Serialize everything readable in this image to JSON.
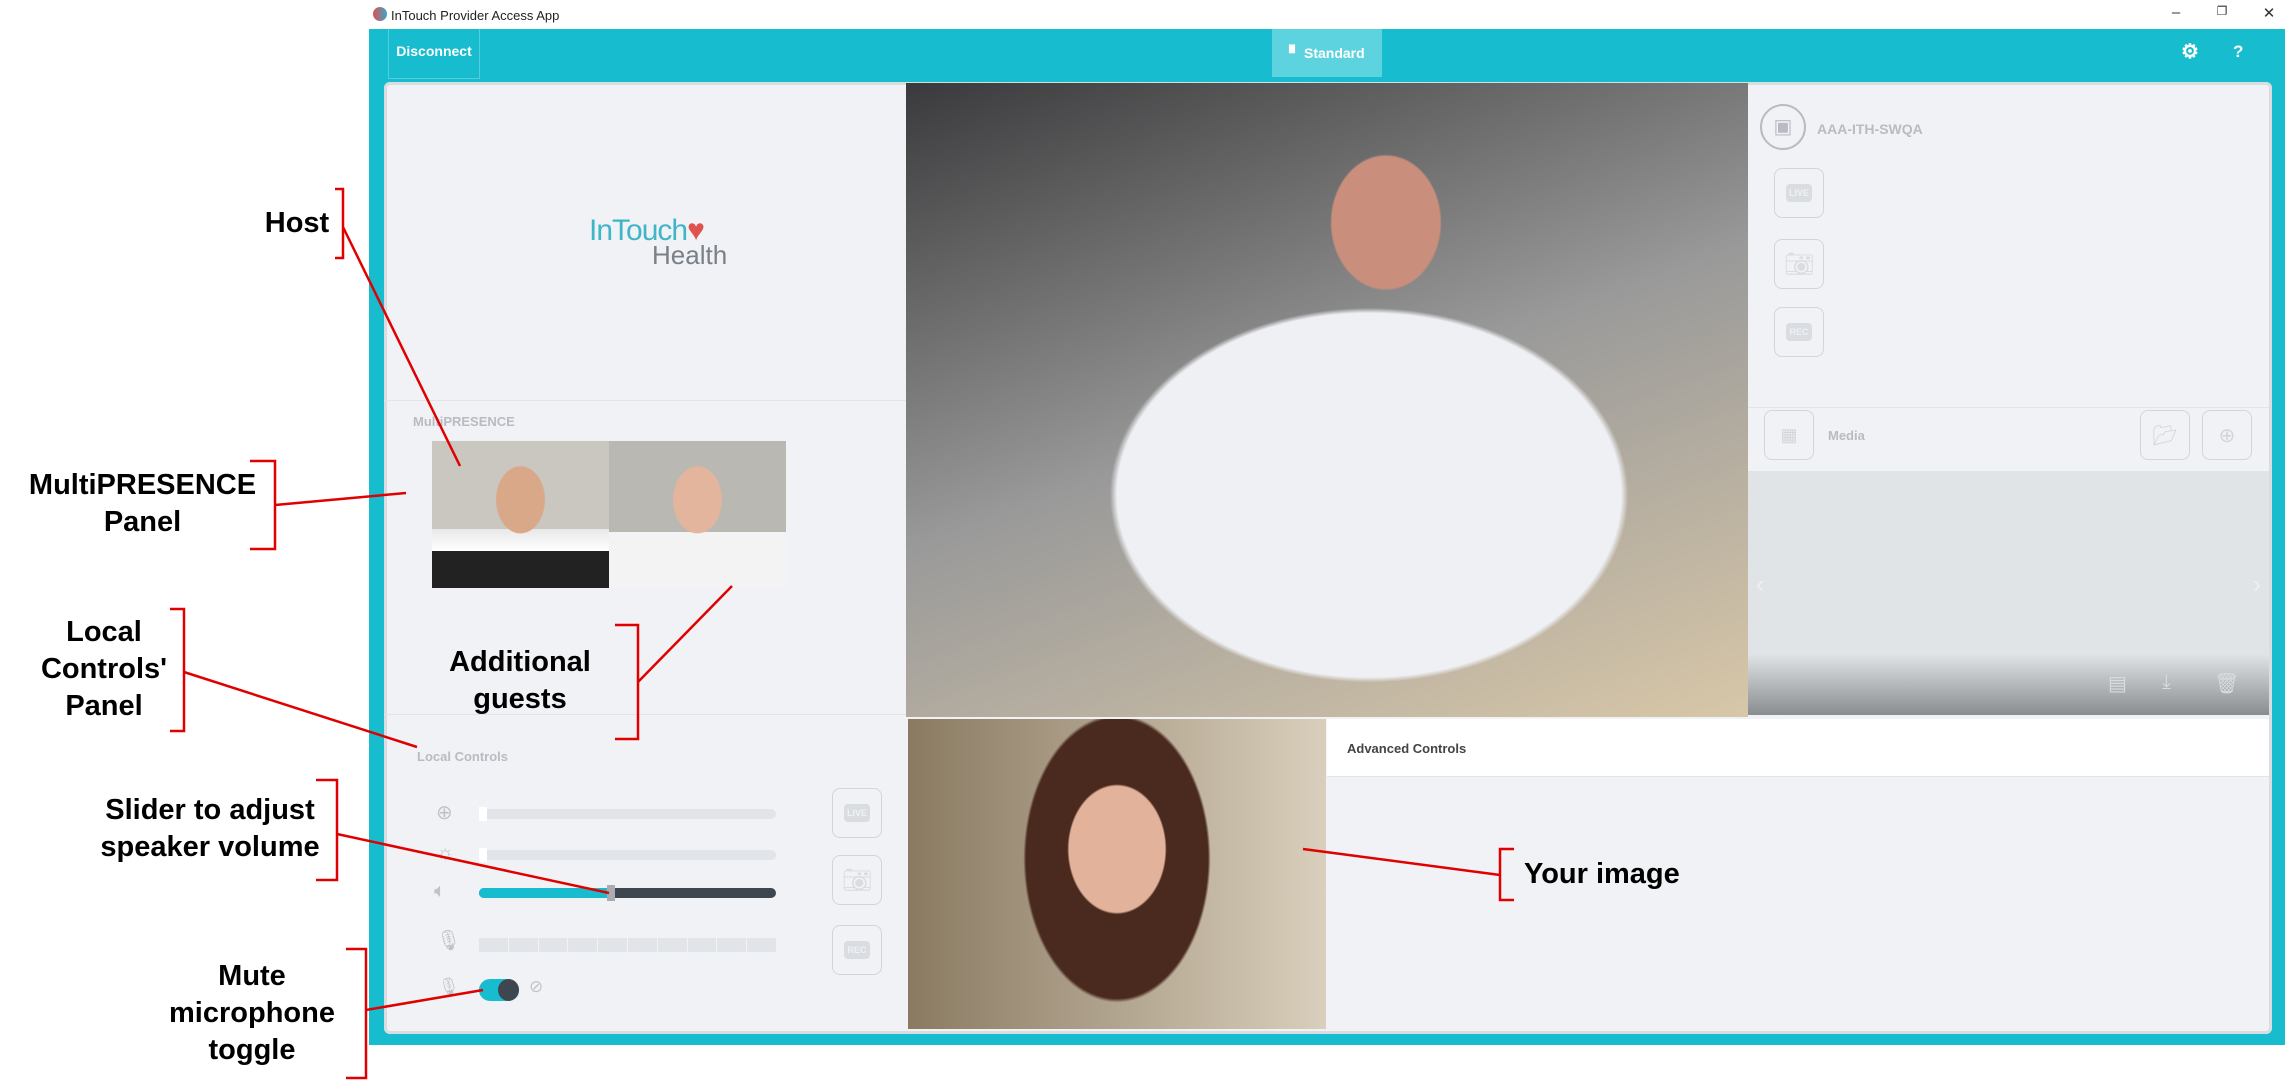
{
  "window": {
    "title": "InTouch Provider Access App",
    "minimize": "–",
    "restore": "❐",
    "close": "✕"
  },
  "toolbar": {
    "disconnect": "Disconnect",
    "mode": "Standard",
    "settings_icon": "gear-icon",
    "help": "?"
  },
  "left_panel": {
    "logo_line1": "InTouch",
    "logo_line2": "Health",
    "multipresence_label": "MultiPRESENCE",
    "local_controls_label": "Local Controls",
    "zoom_level": 0.0,
    "brightness_level": 0.0,
    "speaker_volume": 0.44,
    "mic_level_segments": 10,
    "mute_toggle_on": true
  },
  "buttons": {
    "live": "LIVE",
    "rec": "REC"
  },
  "right_panel": {
    "device_name": "AAA-ITH-SWQA",
    "media_label": "Media",
    "prev": "‹",
    "next": "›"
  },
  "advanced": {
    "title": "Advanced Controls"
  },
  "annotations": {
    "host": "Host",
    "multipresence": [
      "MultiPRESENCE",
      "Panel"
    ],
    "local": [
      "Local",
      "Controls'",
      "Panel"
    ],
    "guests": [
      "Additional",
      "guests"
    ],
    "slider": [
      "Slider to adjust",
      "speaker volume"
    ],
    "mute": [
      "Mute",
      "microphone",
      "toggle"
    ],
    "your_image": "Your image"
  },
  "colors": {
    "accent": "#17bccf",
    "dark": "#3e4650",
    "annotation": "#e00000"
  }
}
